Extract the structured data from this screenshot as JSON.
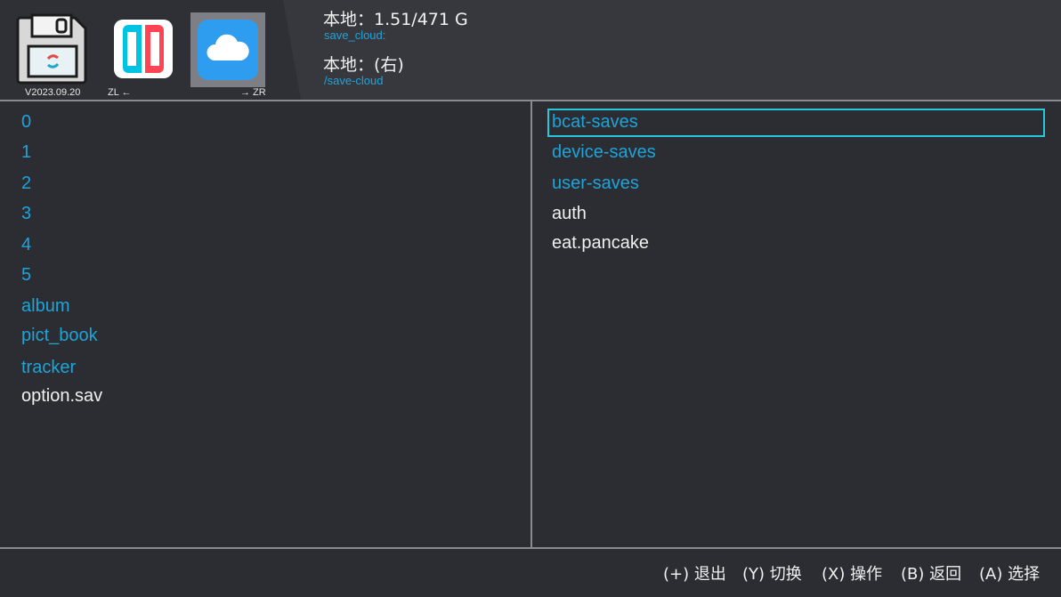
{
  "header": {
    "version": "V2023.09.20",
    "zl_hint": "ZL ←",
    "zr_hint": "→ ZR",
    "storage_line": "本地：1.51/471 G",
    "storage_path": "save_cloud:",
    "pane_line": "本地：(右)",
    "pane_path": "/save-cloud",
    "icons": [
      "save-disk-icon",
      "switch-console-icon",
      "cloud-icon"
    ]
  },
  "left_pane": {
    "entries": [
      {
        "name": "0",
        "type": "dir"
      },
      {
        "name": "1",
        "type": "dir"
      },
      {
        "name": "2",
        "type": "dir"
      },
      {
        "name": "3",
        "type": "dir"
      },
      {
        "name": "4",
        "type": "dir"
      },
      {
        "name": "5",
        "type": "dir"
      },
      {
        "name": "album",
        "type": "dir"
      },
      {
        "name": "pict_book",
        "type": "dir"
      },
      {
        "name": "tracker",
        "type": "dir"
      },
      {
        "name": "option.sav",
        "type": "file"
      }
    ]
  },
  "right_pane": {
    "selected": "bcat-saves",
    "entries": [
      {
        "name": "bcat-saves",
        "type": "dir"
      },
      {
        "name": "device-saves",
        "type": "dir"
      },
      {
        "name": "user-saves",
        "type": "dir"
      },
      {
        "name": "auth",
        "type": "file"
      },
      {
        "name": "eat.pancake",
        "type": "file"
      }
    ]
  },
  "footer": {
    "hints": [
      "(+) 退出",
      "(Y) 切换",
      "(X) 操作",
      "(B) 返回",
      "(A) 选择"
    ]
  },
  "colors": {
    "background": "#2b2d33",
    "header": "#37383d",
    "directory": "#1ea4d9",
    "file": "#f0f0f0",
    "selection": "#29c7de",
    "switch_red": "#ff4554",
    "switch_blue": "#00c3e3",
    "cloud_bg": "#2e9df0"
  }
}
